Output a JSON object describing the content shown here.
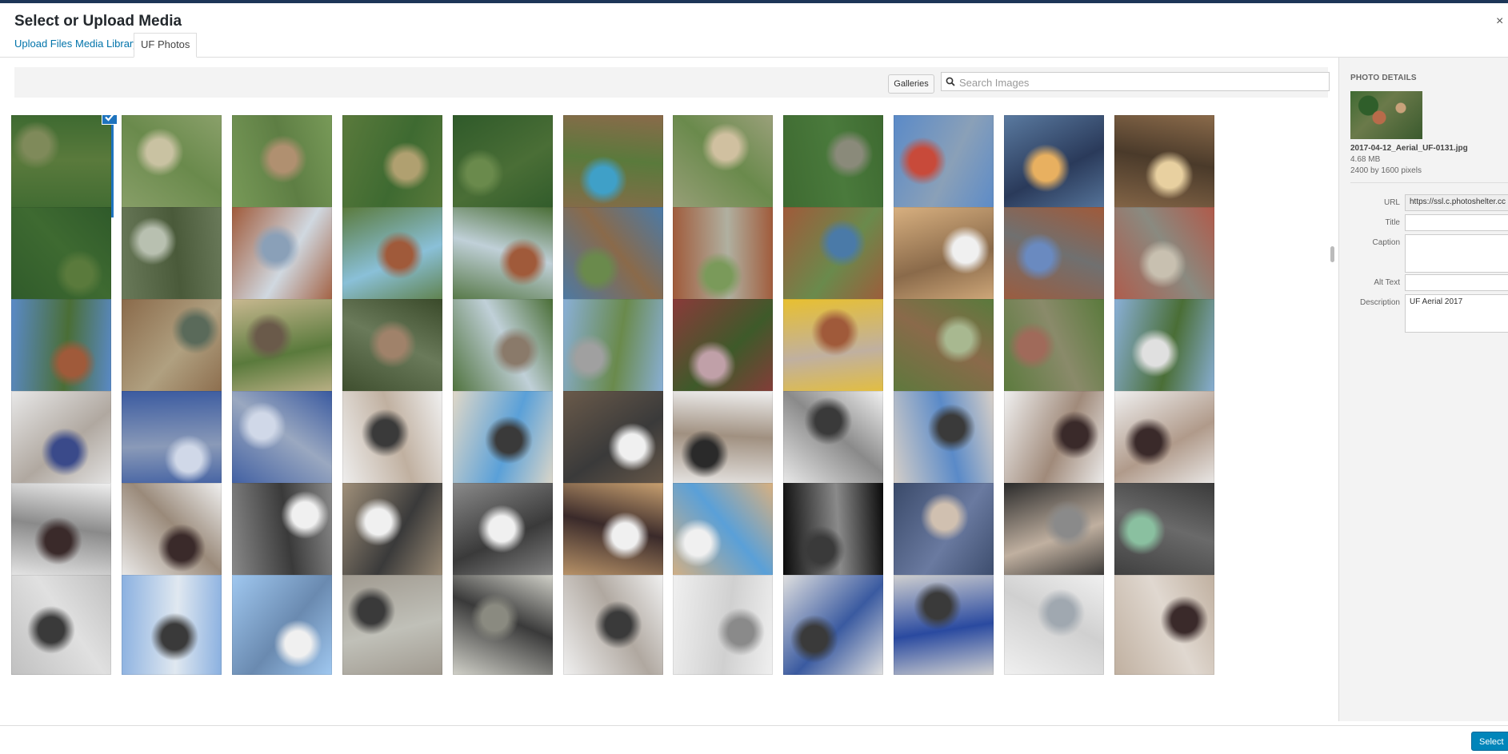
{
  "modal": {
    "title": "Select or Upload Media",
    "close_glyph": "×"
  },
  "tabs": [
    {
      "label": "Upload Files"
    },
    {
      "label": "Media Library"
    },
    {
      "label": "UF Photos",
      "active": true
    }
  ],
  "toolbar": {
    "galleries_label": "Galleries",
    "search_placeholder": "Search Images",
    "search_value": ""
  },
  "photo_grid": {
    "selected_index": 0,
    "rows": 6,
    "columns": 11
  },
  "photo_details": {
    "heading": "PHOTO DETAILS",
    "filename": "2017-04-12_Aerial_UF-0131.jpg",
    "filesize": "4.68 MB",
    "dimensions": "2400 by 1600 pixels",
    "fields": {
      "url_label": "URL",
      "url_value": "https://ssl.c.photoshelter.cc",
      "title_label": "Title",
      "title_value": "",
      "caption_label": "Caption",
      "caption_value": "",
      "alt_label": "Alt Text",
      "alt_value": "",
      "description_label": "Description",
      "description_value": "UF Aerial 2017"
    }
  },
  "footer": {
    "select_label": "Select"
  },
  "colors": {
    "accent": "#1e73be",
    "primary_button": "#0085ba",
    "link": "#0073aa"
  }
}
